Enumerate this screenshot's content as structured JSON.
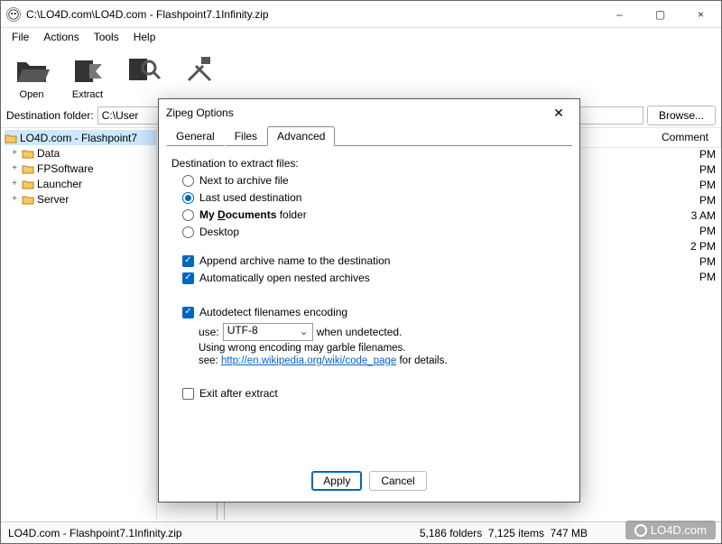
{
  "window": {
    "title": "C:\\LO4D.com\\LO4D.com - Flashpoint7.1Infinity.zip",
    "minimize": "–",
    "maximize": "▢",
    "close": "×"
  },
  "menu": {
    "file": "File",
    "actions": "Actions",
    "tools": "Tools",
    "help": "Help"
  },
  "toolbar": {
    "open": "Open",
    "extract": "Extract"
  },
  "destination": {
    "label": "Destination folder:",
    "value": "C:\\User",
    "browse": "Browse..."
  },
  "tree": {
    "root": "LO4D.com - Flashpoint7",
    "items": [
      "Data",
      "FPSoftware",
      "Launcher",
      "Server"
    ]
  },
  "list": {
    "col_comment": "Comment",
    "visible_modified": [
      "PM",
      "PM",
      "PM",
      "PM",
      "3 AM",
      "PM",
      "2 PM",
      "PM",
      "PM"
    ]
  },
  "status": {
    "filename": "LO4D.com - Flashpoint7.1Infinity.zip",
    "folders": "5,186 folders",
    "items": "7,125 items",
    "size": "747 MB"
  },
  "watermark": "LO4D.com",
  "dialog": {
    "title": "Zipeg Options",
    "close": "✕",
    "tabs": {
      "general": "General",
      "files": "Files",
      "advanced": "Advanced"
    },
    "section": "Destination to extract files:",
    "radios": {
      "next_to": "Next to archive file",
      "last_used": "Last used destination",
      "my_docs_pre": "My ",
      "my_docs_underline": "D",
      "my_docs_rest": "ocuments",
      "my_docs_suffix": " folder",
      "desktop": "Desktop"
    },
    "checks": {
      "append": "Append archive name to the destination",
      "nested": "Automatically open nested archives",
      "autodetect": "Autodetect filenames encoding",
      "exit": "Exit after extract"
    },
    "encoding": {
      "use_label": "use:",
      "value": "UTF-8",
      "when": "when undetected.",
      "note1": "Using wrong encoding may garble filenames.",
      "note2_pre": "see: ",
      "link": "http://en.wikipedia.org/wiki/code_page",
      "note2_post": " for details."
    },
    "buttons": {
      "apply": "Apply",
      "cancel": "Cancel"
    }
  }
}
